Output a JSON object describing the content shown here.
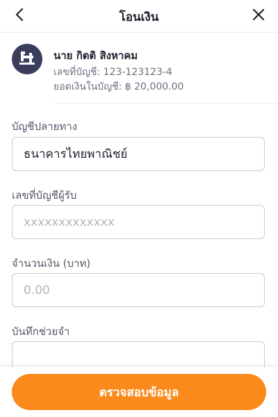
{
  "header": {
    "title": "โอนเงิน",
    "back_icon": "chevron-left-icon",
    "close_icon": "close-icon"
  },
  "account": {
    "avatar_icon": "bank-logo-icon",
    "name": "นาย กิตติ สิงหาคม",
    "account_number": "เลขที่บัญชี: 123-123123-4",
    "balance": "ยอดเงินในบัญชี: ฿ 20,000.00"
  },
  "form": {
    "destination_label": "บัญชีปลายทาง",
    "destination_value": "ธนาคารไทยพาณิชย์",
    "recipient_label": "เลขที่บัญชีผู้รับ",
    "recipient_placeholder": "xxxxxxxxxxxxx",
    "amount_label": "จำนวนเงิน (บาท)",
    "amount_placeholder": "0.00",
    "memo_label": "บันทึกช่วยจำ",
    "memo_value": ""
  },
  "actions": {
    "submit_label": "ตรวจสอบข้อมูล"
  },
  "colors": {
    "accent": "#fb8a1c",
    "avatar_bg": "#3a3d5c",
    "border": "#c9c9d2"
  }
}
